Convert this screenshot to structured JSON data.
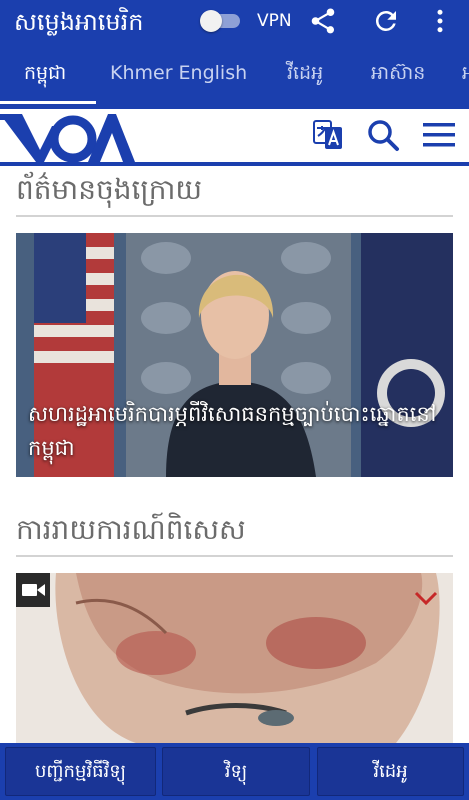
{
  "app": {
    "title": "សម្លេងអាមេរិក",
    "vpn_label": "VPN",
    "vpn_enabled": false,
    "accent_color": "#1b3fae"
  },
  "icons": {
    "share": "share-icon",
    "refresh": "refresh-icon",
    "more": "more-vert-icon",
    "translate": "translate-icon",
    "search": "search-icon",
    "menu": "hamburger-menu-icon",
    "video": "videocam-icon"
  },
  "tabs": [
    {
      "label": "កម្ពុជា",
      "active": true
    },
    {
      "label": "Khmer English",
      "active": false
    },
    {
      "label": "វីដេអូ",
      "active": false
    },
    {
      "label": "អាស៊ាន",
      "active": false
    },
    {
      "label": "អ",
      "active": false
    }
  ],
  "header": {
    "logo_text": "VOA"
  },
  "sections": [
    {
      "title": "ព័ត៌មានចុងក្រោយ",
      "card": {
        "caption": "សហរដ្ឋអាមេរិកបារម្ភពីវិសោធនកម្មច្បាប់បោះឆ្នោតនៅកម្ពុជា",
        "video": false
      }
    },
    {
      "title": "ការរាយការណ៍ពិសេស",
      "card": {
        "caption": "",
        "video": true
      }
    }
  ],
  "bottom_nav": [
    {
      "label": "បញ្ជីកម្មវិធីវិទ្យុ"
    },
    {
      "label": "វិទ្យុ"
    },
    {
      "label": "វីដេអូ"
    }
  ]
}
